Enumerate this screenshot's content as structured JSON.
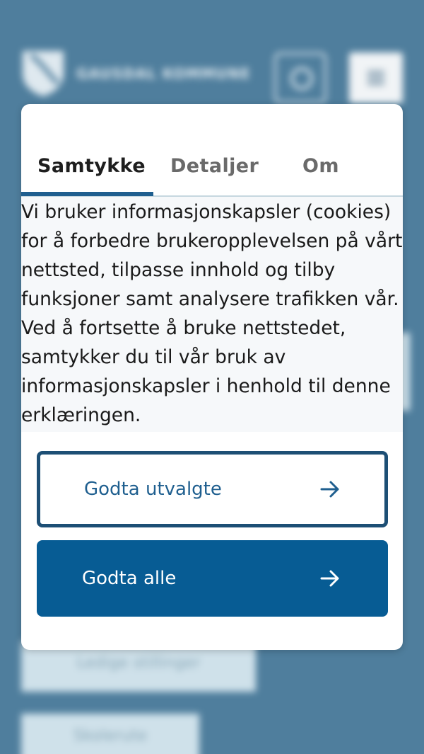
{
  "background": {
    "brand_name": "GAUSDAL KOMMUNE",
    "card_1": "Ledige stillinger",
    "card_2": "Skolerute"
  },
  "cookie_dialog": {
    "tabs": [
      {
        "label": "Samtykke",
        "active": true
      },
      {
        "label": "Detaljer",
        "active": false
      },
      {
        "label": "Om",
        "active": false
      }
    ],
    "body_lines": [
      "Vi bruker informasjonskapsler (cookies)",
      "for å forbedre brukeropplevelsen på vårt",
      "nettsted, tilpasse innhold og tilby",
      "funksjoner samt analysere trafikken vår.",
      "Ved å fortsette å bruke nettstedet,",
      "samtykker du til vår bruk av",
      "informasjonskapsler i henhold til denne",
      "erklæringen."
    ],
    "accept_selected_label": "Godta utvalgte",
    "accept_all_label": "Godta alle"
  },
  "colors": {
    "accent": "#075c94",
    "outline": "#1d4f75",
    "overlay": "#4f7e9d"
  },
  "icons": [
    "search-icon",
    "menu-icon",
    "arrow-right-icon",
    "logo-icon"
  ]
}
